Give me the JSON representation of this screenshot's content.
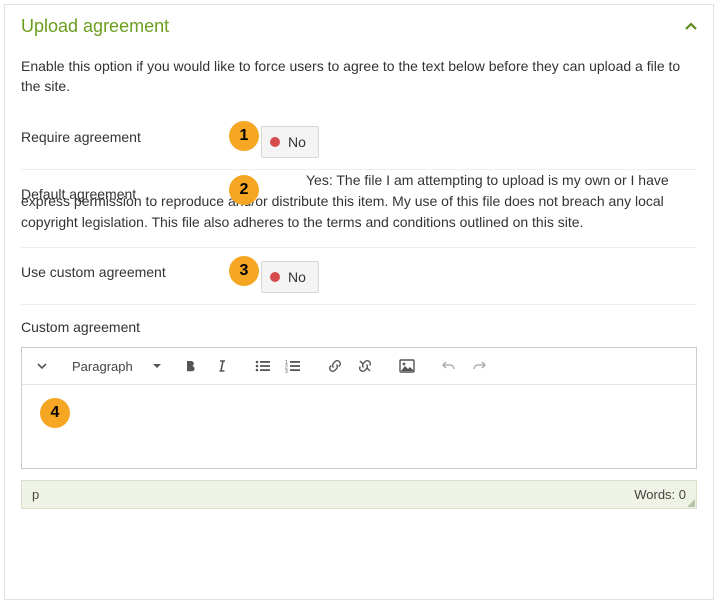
{
  "panel": {
    "title": "Upload agreement"
  },
  "intro": "Enable this option if you would like to force users to agree to the text below before they can upload a file to the site.",
  "badges": {
    "b1": "1",
    "b2": "2",
    "b3": "3",
    "b4": "4"
  },
  "requireAgreement": {
    "label": "Require agreement",
    "value": "No"
  },
  "defaultAgreement": {
    "label": "Default agreement",
    "value": "Yes: The file I am attempting to upload is my own or I have express permission to reproduce and/or distribute this item. My use of this file does not breach any local copyright legislation. This file also adheres to the terms and conditions outlined on this site."
  },
  "useCustom": {
    "label": "Use custom agreement",
    "value": "No"
  },
  "customAgreement": {
    "label": "Custom agreement"
  },
  "editor": {
    "formatSelector": "Paragraph",
    "status": {
      "path": "p",
      "words": "Words: 0"
    }
  }
}
